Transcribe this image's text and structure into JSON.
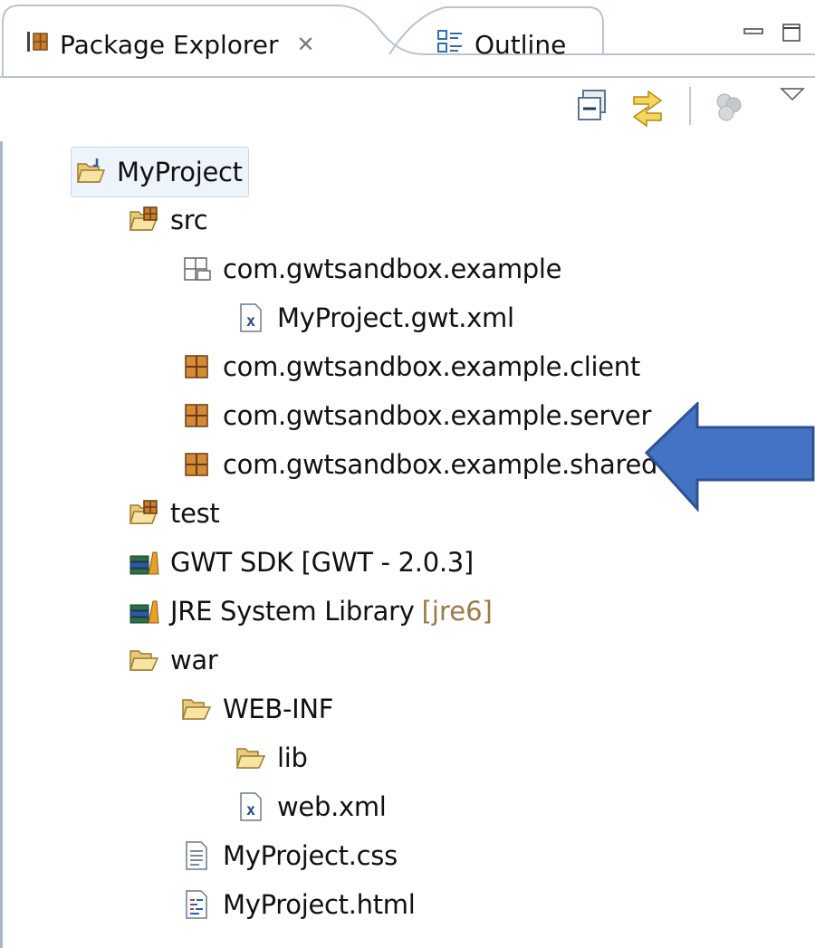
{
  "tabs": [
    {
      "label": "Package Explorer",
      "icon": "package-explorer-icon",
      "closable": true,
      "active": true
    },
    {
      "label": "Outline",
      "icon": "outline-icon",
      "closable": false,
      "active": false
    }
  ],
  "window_controls": [
    "minimize-icon",
    "maximize-icon"
  ],
  "toolbar": [
    "collapse-all-icon",
    "link-with-editor-icon",
    "focus-on-working-set-icon",
    "view-menu-icon"
  ],
  "tree": [
    {
      "label": "MyProject",
      "icon": "project-folder-icon",
      "depth": 0,
      "selected": true
    },
    {
      "label": "src",
      "icon": "source-folder-icon",
      "depth": 1
    },
    {
      "label": "com.gwtsandbox.example",
      "icon": "empty-package-icon",
      "depth": 2
    },
    {
      "label": "MyProject.gwt.xml",
      "icon": "xml-file-icon",
      "depth": 3
    },
    {
      "label": "com.gwtsandbox.example.client",
      "icon": "package-icon",
      "depth": 2
    },
    {
      "label": "com.gwtsandbox.example.server",
      "icon": "package-icon",
      "depth": 2
    },
    {
      "label": "com.gwtsandbox.example.shared",
      "icon": "package-icon",
      "depth": 2
    },
    {
      "label": "test",
      "icon": "source-folder-icon",
      "depth": 1
    },
    {
      "label": "GWT SDK [GWT - 2.0.3]",
      "icon": "library-icon",
      "depth": 1
    },
    {
      "label": "JRE System Library",
      "decoration": "[jre6]",
      "icon": "library-icon",
      "depth": 1
    },
    {
      "label": "war",
      "icon": "folder-icon",
      "depth": 1
    },
    {
      "label": "WEB-INF",
      "icon": "folder-icon",
      "depth": 2
    },
    {
      "label": "lib",
      "icon": "folder-icon",
      "depth": 3
    },
    {
      "label": "web.xml",
      "icon": "xml-file-icon",
      "depth": 3
    },
    {
      "label": "MyProject.css",
      "icon": "text-file-icon",
      "depth": 2
    },
    {
      "label": "MyProject.html",
      "icon": "html-file-icon",
      "depth": 2
    }
  ],
  "annotation": {
    "icon": "callout-arrow-icon",
    "color": "#4472c4",
    "stroke": "#2f528f"
  }
}
